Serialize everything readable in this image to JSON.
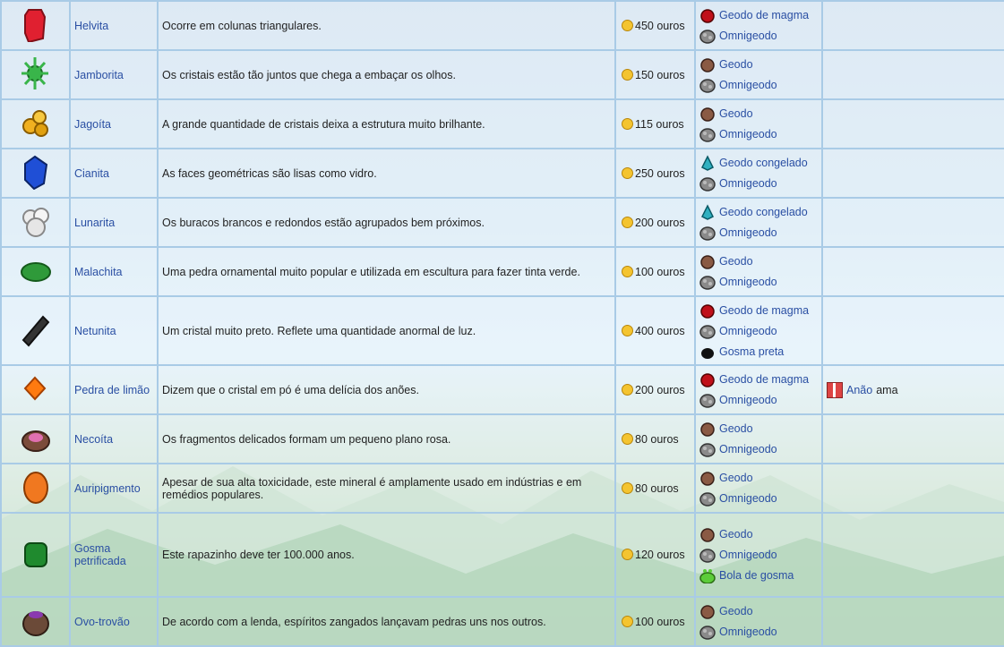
{
  "rows": [
    {
      "name": "Helvita",
      "desc": "Ocorre em colunas triangulares.",
      "price": "450 ouros",
      "sources": [
        {
          "icon": "magma-geode-icon",
          "label": "Geodo de magma"
        },
        {
          "icon": "omni-geode-icon",
          "label": "Omnigeodo"
        }
      ],
      "gift": null
    },
    {
      "name": "Jamborita",
      "desc": "Os cristais estão tão juntos que chega a embaçar os olhos.",
      "price": "150 ouros",
      "sources": [
        {
          "icon": "geode-icon",
          "label": "Geodo"
        },
        {
          "icon": "omni-geode-icon",
          "label": "Omnigeodo"
        }
      ],
      "gift": null
    },
    {
      "name": "Jagoíta",
      "desc": "A grande quantidade de cristais deixa a estrutura muito brilhante.",
      "price": "115 ouros",
      "sources": [
        {
          "icon": "geode-icon",
          "label": "Geodo"
        },
        {
          "icon": "omni-geode-icon",
          "label": "Omnigeodo"
        }
      ],
      "gift": null
    },
    {
      "name": "Cianita",
      "desc": "As faces geométricas são lisas como vidro.",
      "price": "250 ouros",
      "sources": [
        {
          "icon": "frozen-geode-icon",
          "label": "Geodo congelado"
        },
        {
          "icon": "omni-geode-icon",
          "label": "Omnigeodo"
        }
      ],
      "gift": null
    },
    {
      "name": "Lunarita",
      "desc": "Os buracos brancos e redondos estão agrupados bem próximos.",
      "price": "200 ouros",
      "sources": [
        {
          "icon": "frozen-geode-icon",
          "label": "Geodo congelado"
        },
        {
          "icon": "omni-geode-icon",
          "label": "Omnigeodo"
        }
      ],
      "gift": null
    },
    {
      "name": "Malachita",
      "desc": "Uma pedra ornamental muito popular e utilizada em escultura para fazer tinta verde.",
      "price": "100 ouros",
      "sources": [
        {
          "icon": "geode-icon",
          "label": "Geodo"
        },
        {
          "icon": "omni-geode-icon",
          "label": "Omnigeodo"
        }
      ],
      "gift": null
    },
    {
      "name": "Netunita",
      "desc": "Um cristal muito preto. Reflete uma quantidade anormal de luz.",
      "price": "400 ouros",
      "sources": [
        {
          "icon": "magma-geode-icon",
          "label": "Geodo de magma"
        },
        {
          "icon": "omni-geode-icon",
          "label": "Omnigeodo"
        },
        {
          "icon": "black-slime-icon",
          "label": "Gosma preta"
        }
      ],
      "gift": null
    },
    {
      "name": "Pedra de limão",
      "desc": "Dizem que o cristal em pó é uma delícia dos anões.",
      "price": "200 ouros",
      "sources": [
        {
          "icon": "magma-geode-icon",
          "label": "Geodo de magma"
        },
        {
          "icon": "omni-geode-icon",
          "label": "Omnigeodo"
        }
      ],
      "gift": {
        "npc": "Anão",
        "verb": "ama"
      }
    },
    {
      "name": "Necoíta",
      "desc": "Os fragmentos delicados formam um pequeno plano rosa.",
      "price": "80 ouros",
      "sources": [
        {
          "icon": "geode-icon",
          "label": "Geodo"
        },
        {
          "icon": "omni-geode-icon",
          "label": "Omnigeodo"
        }
      ],
      "gift": null
    },
    {
      "name": "Auripigmento",
      "desc": "Apesar de sua alta toxicidade, este mineral é amplamente usado em indústrias e em remédios populares.",
      "price": "80 ouros",
      "sources": [
        {
          "icon": "geode-icon",
          "label": "Geodo"
        },
        {
          "icon": "omni-geode-icon",
          "label": "Omnigeodo"
        }
      ],
      "gift": null
    },
    {
      "name": "Gosma petrificada",
      "desc": "Este rapazinho deve ter 100.000 anos.",
      "price": "120 ouros",
      "sources": [
        {
          "icon": "geode-icon",
          "label": "Geodo"
        },
        {
          "icon": "omni-geode-icon",
          "label": "Omnigeodo"
        },
        {
          "icon": "slime-ball-icon",
          "label": "Bola de gosma"
        }
      ],
      "gift": null
    },
    {
      "name": "Ovo-trovão",
      "desc": "De acordo com a lenda, espíritos zangados lançavam pedras uns nos outros.",
      "price": "100 ouros",
      "sources": [
        {
          "icon": "geode-icon",
          "label": "Geodo"
        },
        {
          "icon": "omni-geode-icon",
          "label": "Omnigeodo"
        }
      ],
      "gift": null
    }
  ]
}
